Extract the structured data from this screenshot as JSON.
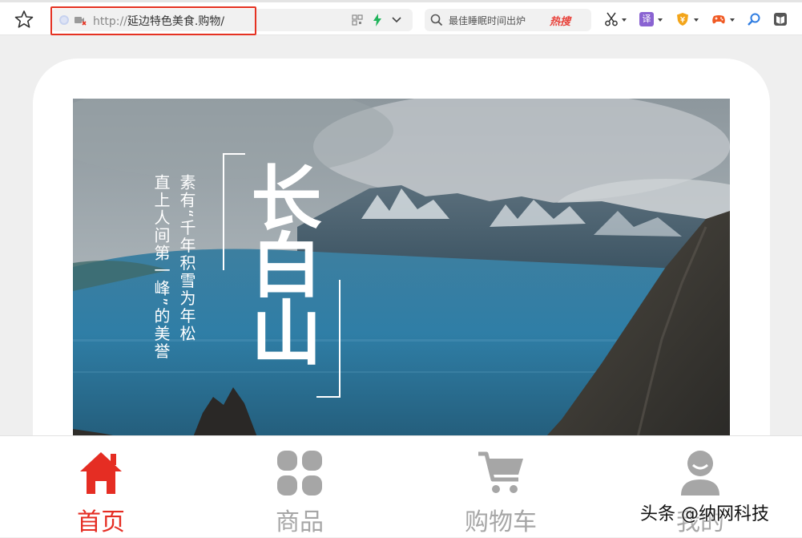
{
  "browser": {
    "url_protocol": "http://",
    "url_domain": "延边特色美食.购物/",
    "search_query": "最佳睡眠时间出炉",
    "hot_label": "热搜",
    "translate_label": "译"
  },
  "hero": {
    "title": "长白山",
    "tagline_line1": "素有“千年积雪为年松",
    "tagline_line2": "直上人间第一峰”的美誉"
  },
  "tabbar": {
    "tabs": [
      {
        "label": "首页",
        "icon": "home-icon",
        "active": true
      },
      {
        "label": "商品",
        "icon": "grid-icon",
        "active": false
      },
      {
        "label": "购物车",
        "icon": "cart-icon",
        "active": false
      },
      {
        "label": "我的",
        "icon": "user-icon",
        "active": false
      }
    ]
  },
  "watermark": "头条 @纳网科技",
  "colors": {
    "accent": "#e52d23",
    "inactive": "#a6a6a6",
    "address_highlight": "#e53222"
  }
}
